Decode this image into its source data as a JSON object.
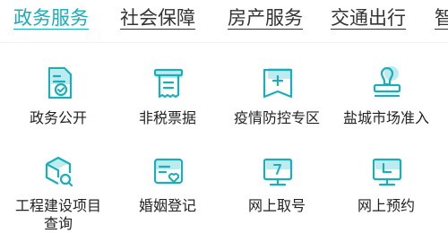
{
  "tabs": [
    {
      "label": "政务服务",
      "active": true
    },
    {
      "label": "社会保障",
      "active": false
    },
    {
      "label": "房产服务",
      "active": false
    },
    {
      "label": "交通出行",
      "active": false
    },
    {
      "label": "智",
      "active": false
    }
  ],
  "services": [
    {
      "label": "政务公开",
      "icon": "document-check-icon"
    },
    {
      "label": "非税票据",
      "icon": "receipt-icon"
    },
    {
      "label": "疫情防控专区",
      "icon": "medical-cross-icon"
    },
    {
      "label": "盐城市场准入",
      "icon": "stamp-icon"
    },
    {
      "label": "工程建设项目",
      "label2": "查询",
      "icon": "box-search-icon"
    },
    {
      "label": "婚姻登记",
      "icon": "heart-card-icon"
    },
    {
      "label": "网上取号",
      "icon": "queue-display-icon"
    },
    {
      "label": "网上预约",
      "icon": "clock-monitor-icon"
    }
  ],
  "colors": {
    "accent": "#1aaeb8",
    "icon_light": "#bdebf0",
    "text": "#222222"
  }
}
